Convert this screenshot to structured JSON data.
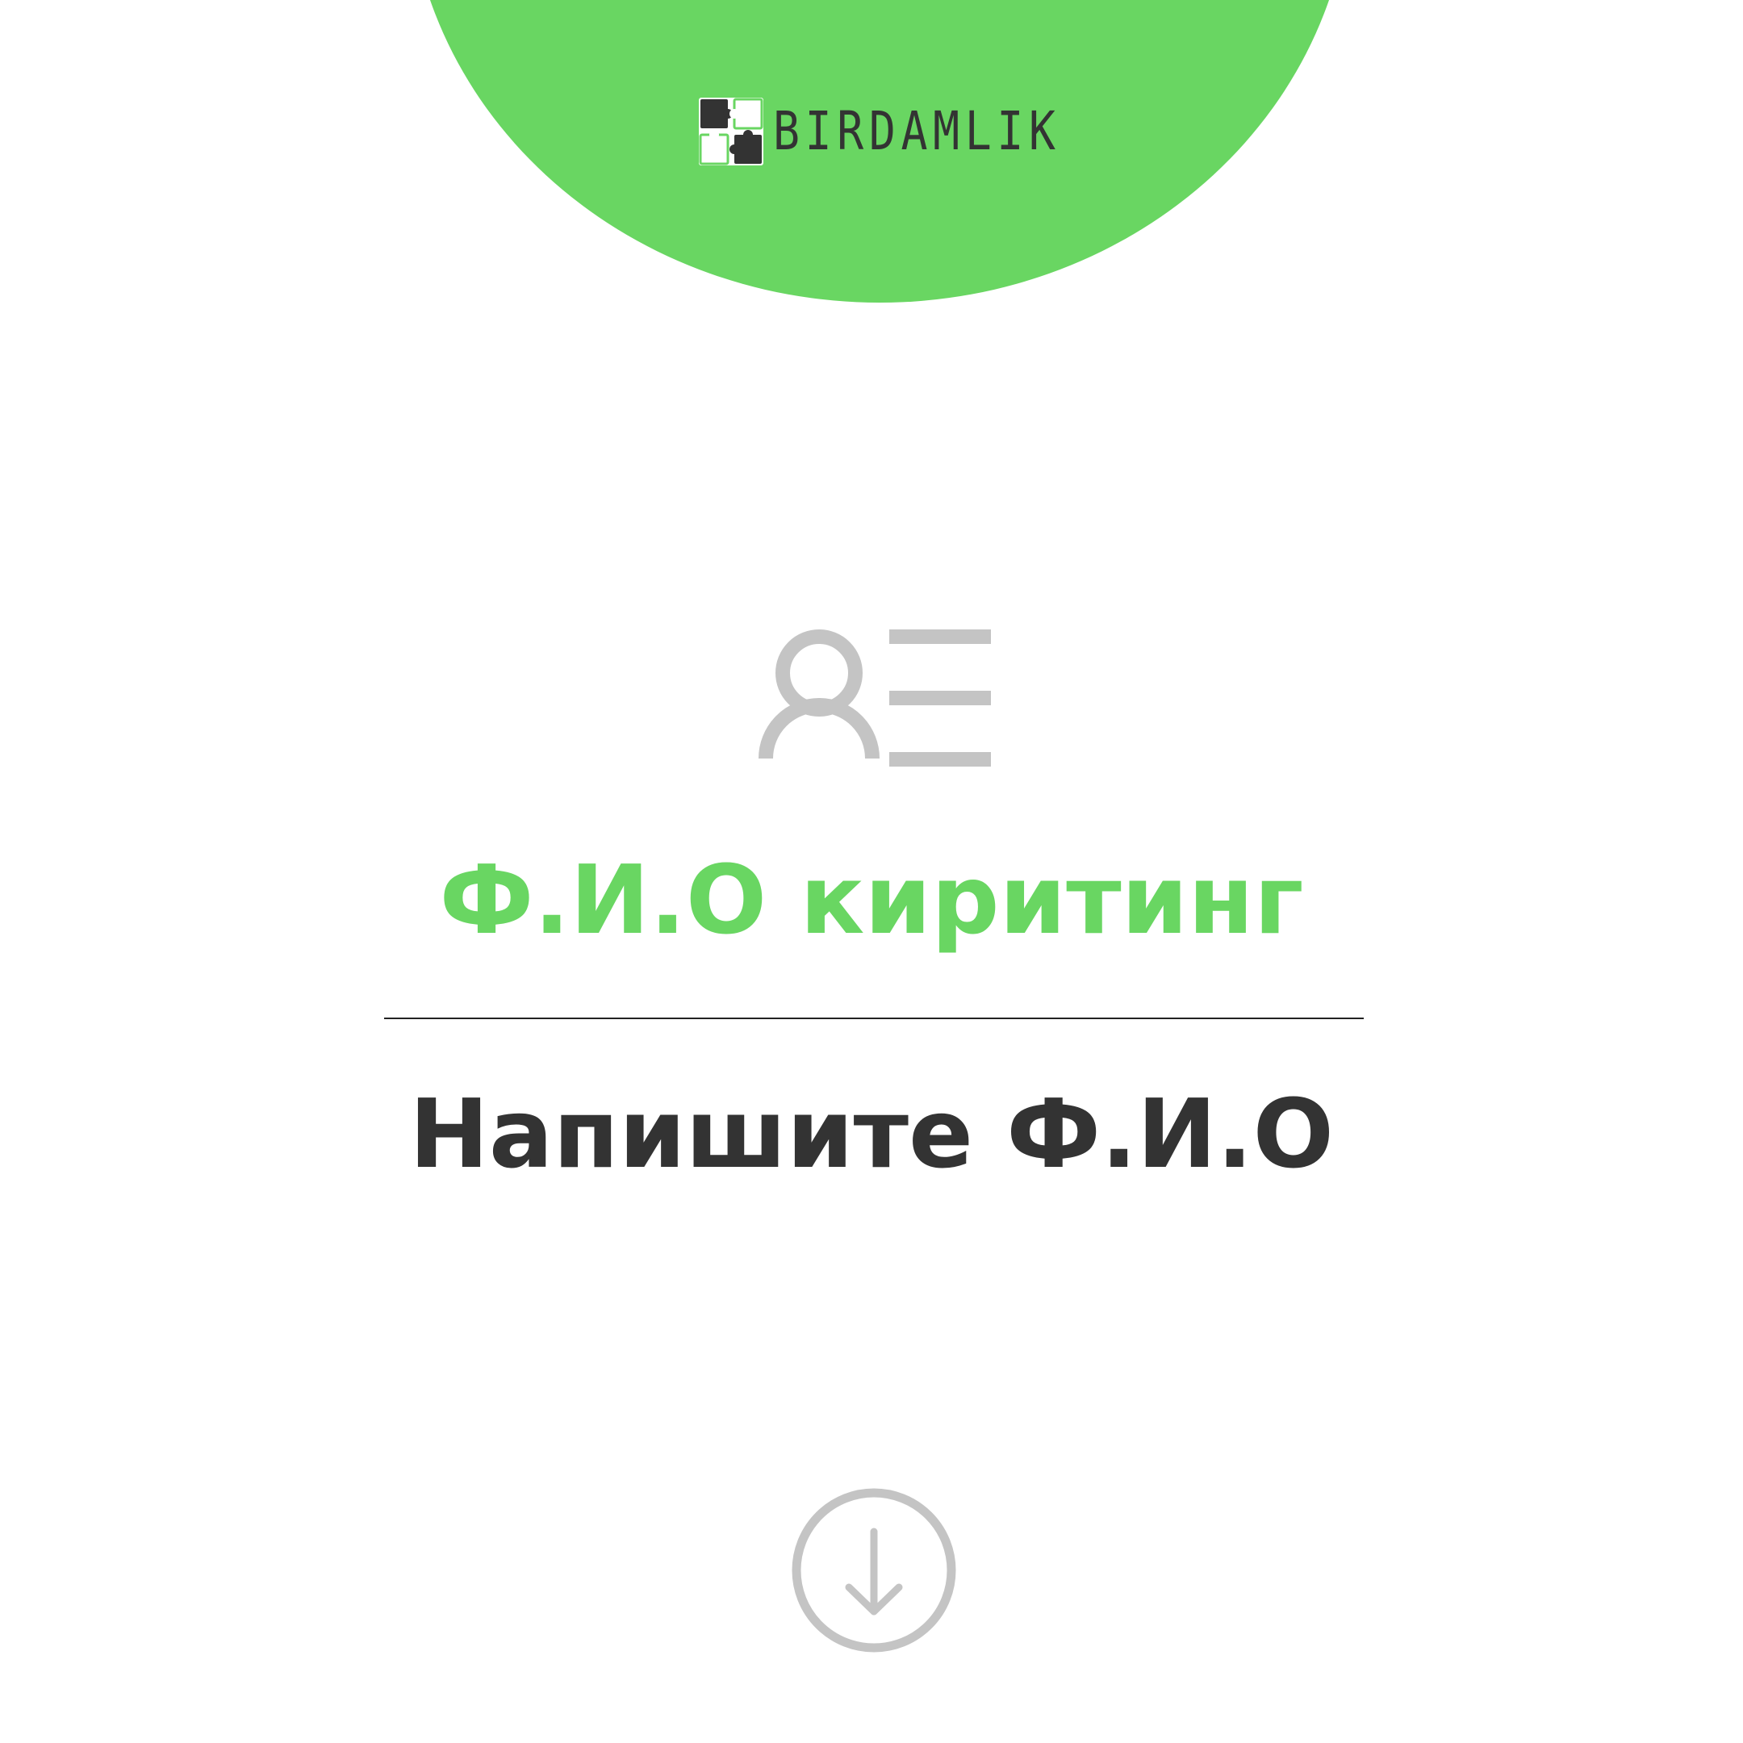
{
  "brand": {
    "name": "BIRDAMLIK",
    "logo_icon": "puzzle-pieces-icon"
  },
  "colors": {
    "accent": "#69d662",
    "text_dark": "#333333",
    "icon_gray": "#c4c4c4",
    "background": "#ffffff"
  },
  "profile_icon": "user-list-icon",
  "title": "Ф.И.О киритинг",
  "subtitle": "Напишите Ф.И.О",
  "next_button_icon": "arrow-down-circle-icon"
}
